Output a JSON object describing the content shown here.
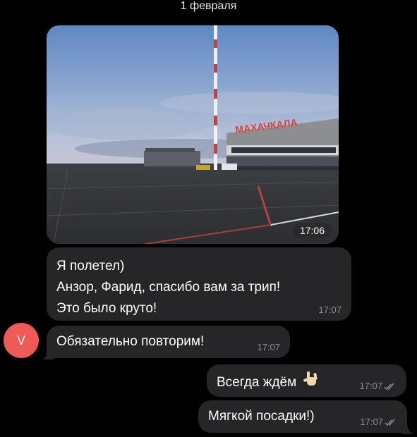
{
  "date_separator": "1 февраля",
  "photo": {
    "time": "17:06",
    "sign_text": "МАХАЧКАЛА"
  },
  "messages": [
    {
      "lines": [
        "Я полетел)",
        "Анзор, Фарид, спасибо вам за трип!",
        "Это было круто!"
      ],
      "time": "17:07"
    },
    {
      "text": "Обязательно повторим!",
      "time": "17:07",
      "avatar_letter": "V"
    },
    {
      "text": "Всегда ждём",
      "emoji": "love-you-gesture-icon",
      "time": "17:07"
    },
    {
      "text": "Мягкой посадки!)",
      "time": "17:07"
    }
  ],
  "colors": {
    "background": "#000000",
    "bubble": "#262628",
    "avatar": "#ef5a57",
    "time": "#8e8e93"
  }
}
